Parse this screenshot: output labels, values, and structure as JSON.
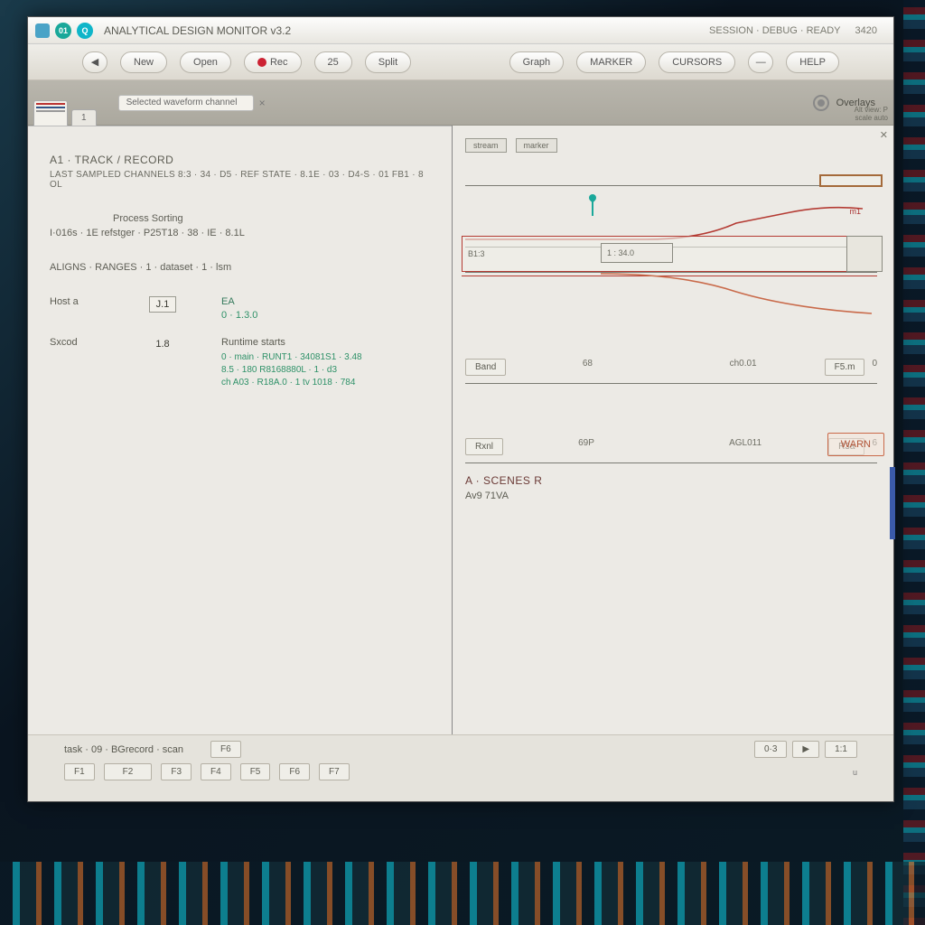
{
  "titlebar": {
    "badge1": "01",
    "badge2": "Q",
    "title": "ANALYTICAL DESIGN MONITOR v3.2",
    "right_hint": "SESSION · DEBUG · READY",
    "counter": "3420"
  },
  "toolbar": {
    "b1": "New",
    "b2": "Open",
    "b3": "Rec",
    "b4": "25",
    "b5": "Split",
    "b6": "Graph",
    "b7": "MARKER",
    "b8": "CURSORS",
    "b9": "—",
    "b10": "HELP"
  },
  "ribbon": {
    "tab1": "1",
    "field_label": "Selected waveform channel",
    "mode_label": "Overlays",
    "meta1": "Alt view: P",
    "meta2": "scale auto"
  },
  "left": {
    "sec1_title": "A1 · TRACK / RECORD",
    "sec1_sub": "LAST SAMPLED CHANNELS 8:3 · 34 · D5 · REF STATE · 8.1E · 03 · D4-S · 01 FB1 · 8 OL",
    "sec2_center": "Process Sorting",
    "sec2_line": "I·016s · 1E refstger · P25T18 · 38 · IE · 8.1L",
    "sec3_line": "ALIGNS · RANGES · 1 · dataset · 1 · lsm",
    "kv1_label": "Host a",
    "kv1_box": "J.1",
    "kv1_v1": "EA",
    "kv1_v2": "0 · 1.3.0",
    "kv2_label": "Sxcod",
    "kv2_box": "1.8",
    "kv2_title": "Runtime starts",
    "kv2_l1": "0 · main · RUNT1 · 34081S1 · 3.48",
    "kv2_l2": "8.5 · 180 R8168880L · 1 · d3",
    "kv2_l3": "ch A03 · R18A.0 · 1 tv 1018 · 784"
  },
  "right": {
    "legend1": "stream",
    "legend2": "marker",
    "track1": "B1:3",
    "track2": "1 : 34.0",
    "tag1": "m1",
    "col1": "Band",
    "col2": "68",
    "col3": "ch0.01",
    "col4": "F5.m",
    "col5": "0",
    "col_b1": "Rxnl",
    "col_b2": "69P",
    "col_b3": "AGL011",
    "col_b4": "R3a",
    "col_b5": "6",
    "callout": "WARN",
    "panel_title": "A · SCENES R",
    "panel_sub": "Av9 71VA"
  },
  "footer": {
    "status": "task · 09 · BGrecord · scan",
    "c1": "F1",
    "c2": "F2",
    "c3": "F3",
    "c4": "F4",
    "c5": "F5",
    "c6": "F6",
    "c7": "F7",
    "r1": "0·3",
    "r2": "▶",
    "r3": "1:1",
    "r_small": "u"
  }
}
